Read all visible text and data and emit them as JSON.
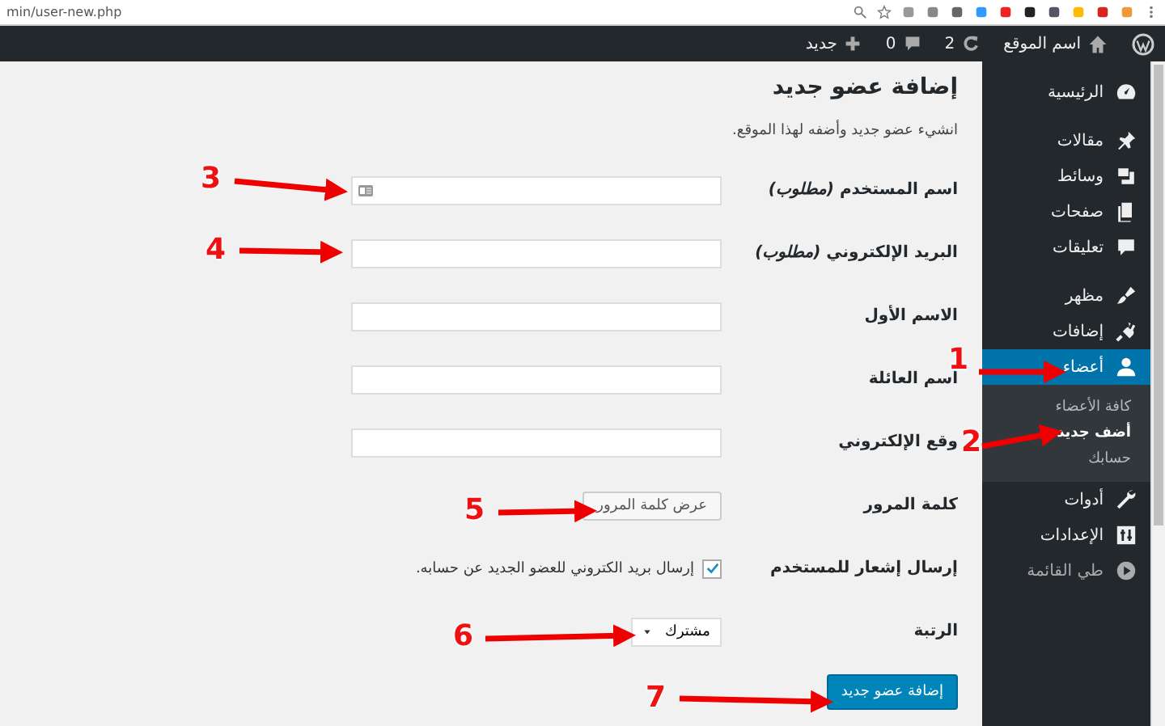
{
  "browser": {
    "url": "min/user-new.php"
  },
  "admin_bar": {
    "site_name": "اسم الموقع",
    "updates": "2",
    "comments": "0",
    "new": "جديد"
  },
  "sidebar": {
    "items": [
      {
        "kind": "menu",
        "label": "الرئيسية",
        "selected": false
      },
      {
        "kind": "menu",
        "label": "مقالات",
        "selected": false
      },
      {
        "kind": "menu",
        "label": "وسائط",
        "selected": false
      },
      {
        "kind": "menu",
        "label": "صفحات",
        "selected": false
      },
      {
        "kind": "menu",
        "label": "تعليقات",
        "selected": false
      },
      {
        "kind": "menu",
        "label": "مظهر",
        "selected": false
      },
      {
        "kind": "menu",
        "label": "إضافات",
        "selected": false
      },
      {
        "kind": "menu",
        "label": "أعضاء",
        "selected": true,
        "submenu": [
          {
            "label": "كافة الأعضاء",
            "selected": false
          },
          {
            "label": "أضف جديد",
            "selected": true
          },
          {
            "label": "حسابك",
            "selected": false
          }
        ]
      },
      {
        "kind": "menu",
        "label": "أدوات",
        "selected": false
      },
      {
        "kind": "menu",
        "label": "الإعدادات",
        "selected": false
      },
      {
        "kind": "collapse",
        "label": "طي القائمة",
        "selected": false
      }
    ]
  },
  "page": {
    "title": "إضافة عضو جديد",
    "description": "انشيء عضو جديد وأضفه لهذا الموقع.",
    "fields": [
      {
        "kind": "text",
        "label": "اسم المستخدم *(مطلوب)*"
      },
      {
        "kind": "text",
        "label": "البريد الإلكتروني *(مطلوب)*"
      },
      {
        "kind": "text",
        "label": "الاسم الأول"
      },
      {
        "kind": "text",
        "label": "اسم العائلة"
      },
      {
        "kind": "text",
        "label": "وقع الإلكتروني"
      },
      {
        "kind": "button",
        "label": "كلمة المرور",
        "button": "عرض كلمة المرور"
      },
      {
        "kind": "checkbox",
        "label": "إرسال إشعار للمستخدم",
        "checked": true,
        "text": "إرسال بريد الكتروني للعضو الجديد عن حسابه."
      },
      {
        "kind": "select",
        "label": "الرتبة",
        "value": "مشترك"
      }
    ],
    "submit": "إضافة عضو جديد"
  },
  "annotations": [
    {
      "label": "1"
    },
    {
      "label": "2"
    },
    {
      "label": "3"
    },
    {
      "label": "4"
    },
    {
      "label": "5"
    },
    {
      "label": "6"
    },
    {
      "label": "7"
    }
  ]
}
